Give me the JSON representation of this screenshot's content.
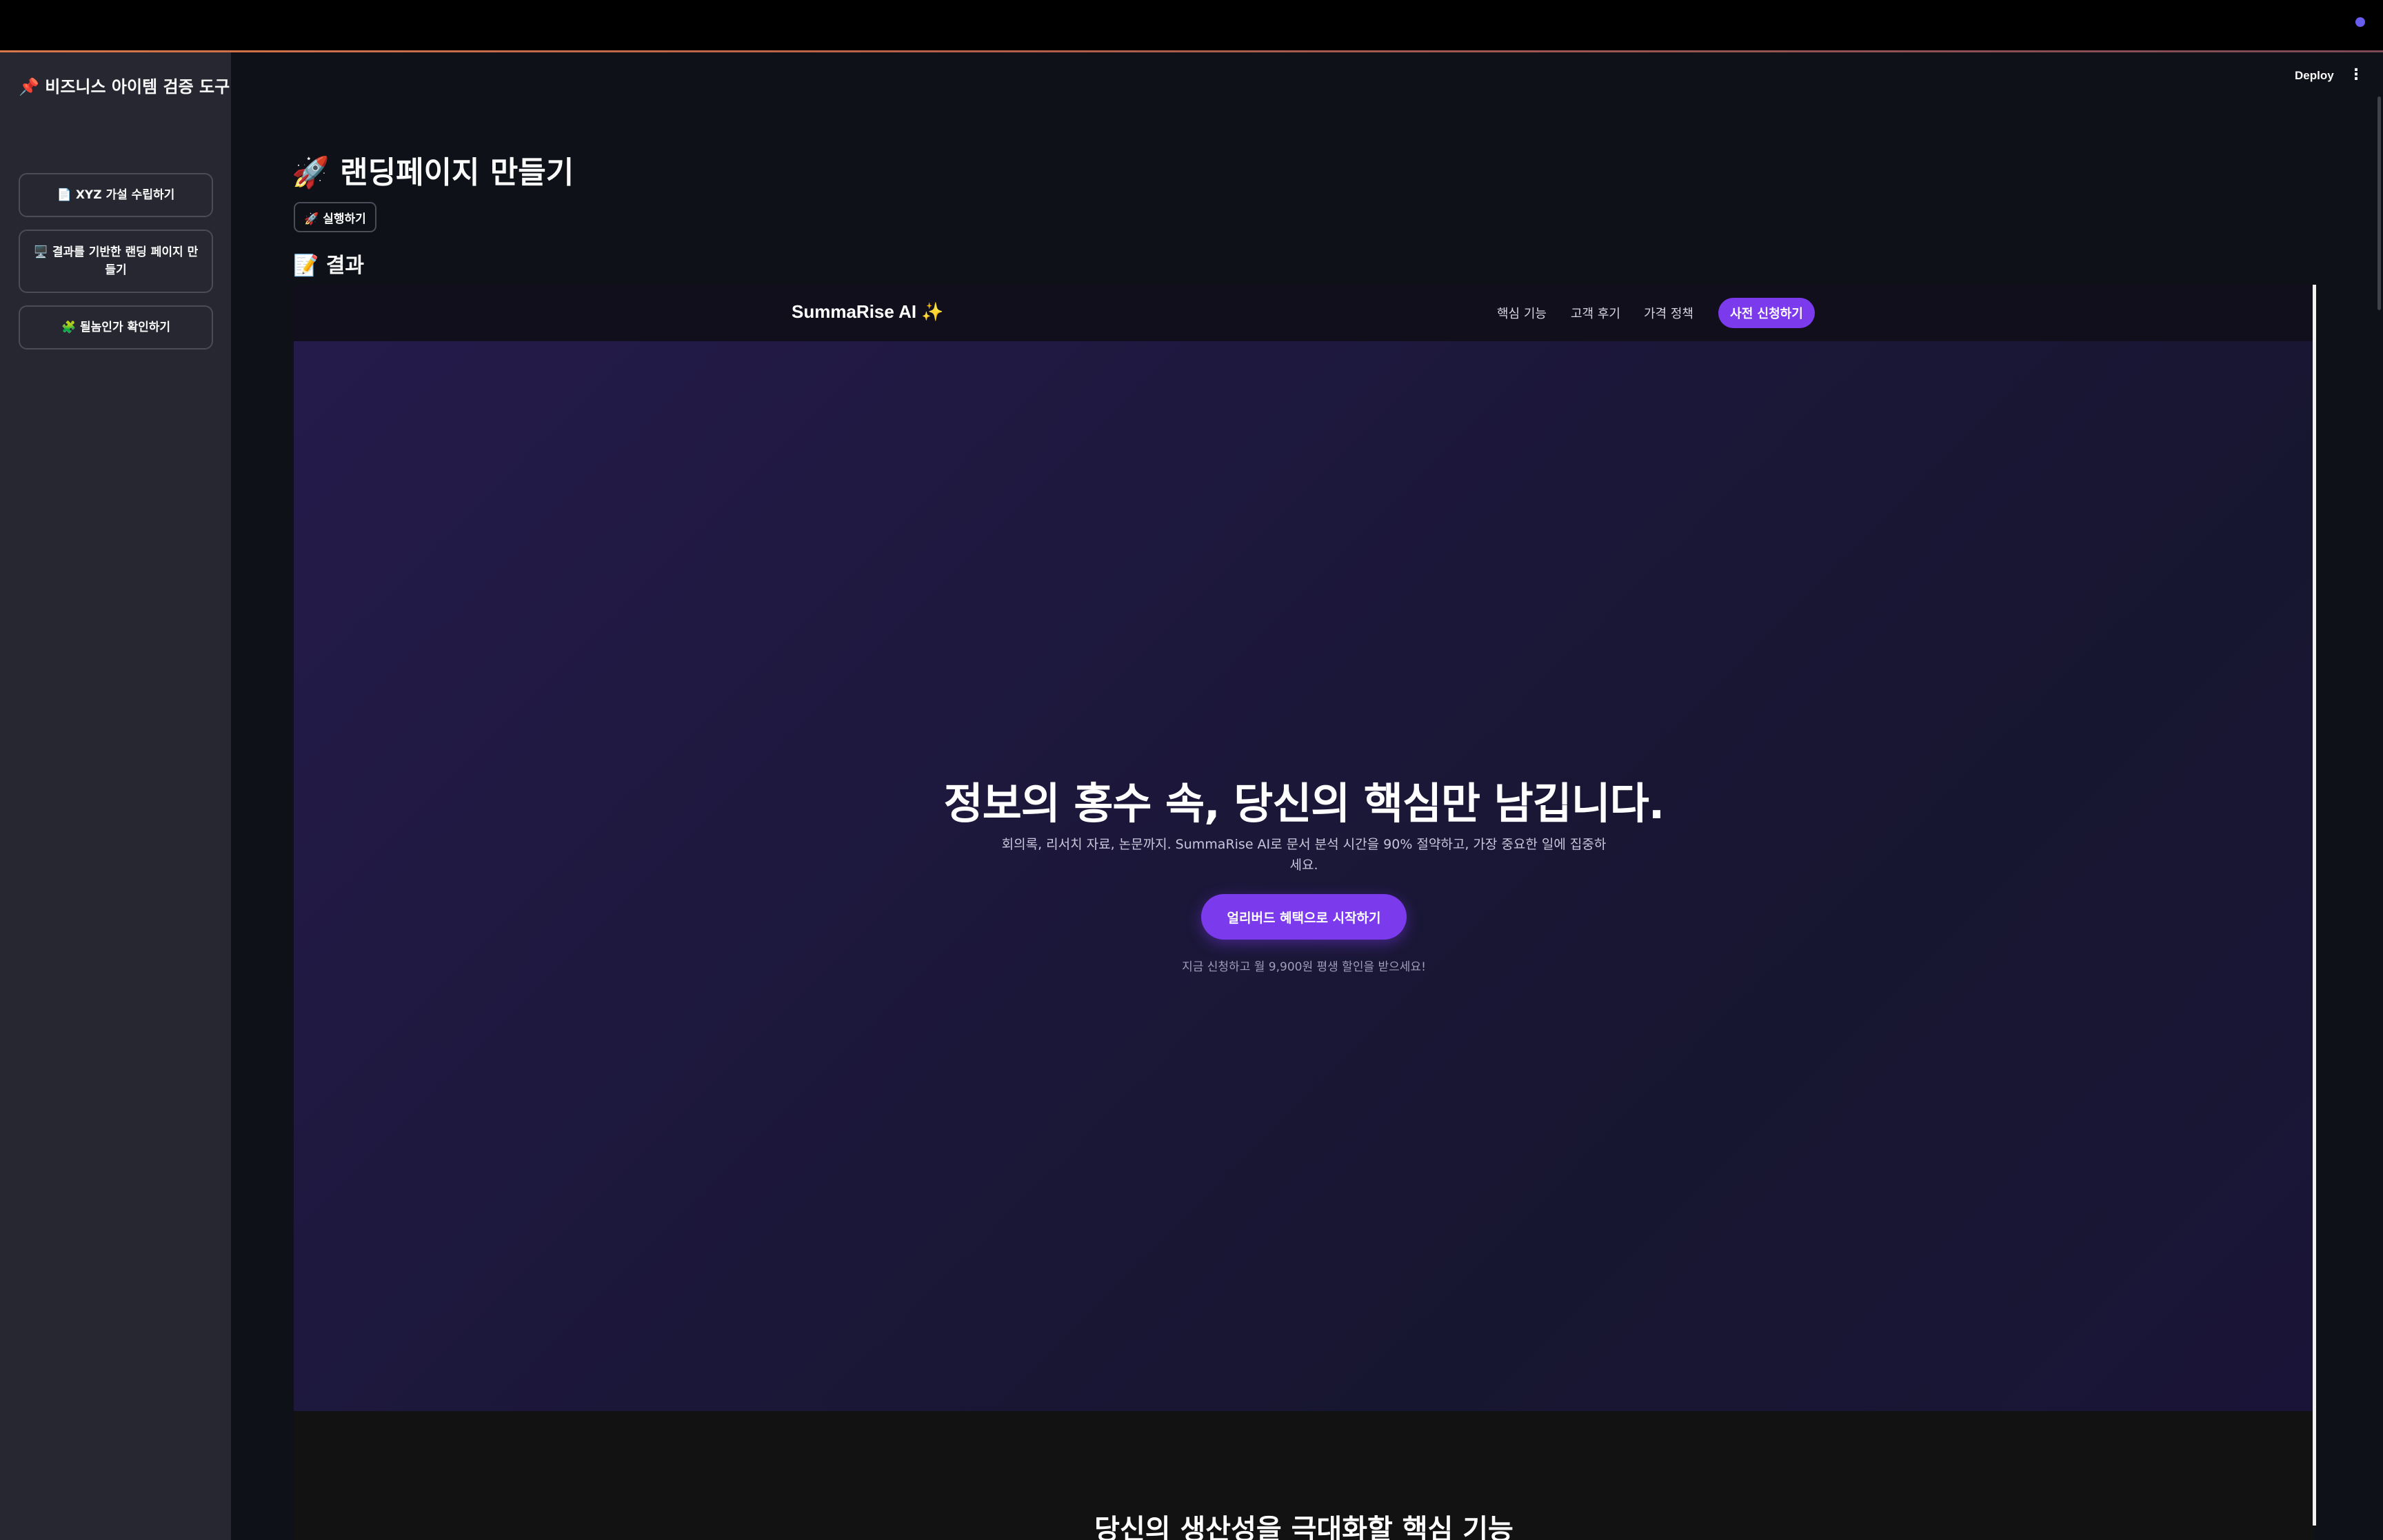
{
  "app": {
    "deploy_label": "Deploy",
    "menu_icon": "⋮"
  },
  "sidebar": {
    "title": "📌 비즈니스 아이템 검증 도구",
    "items": [
      {
        "label": "📄 XYZ 가설 수립하기"
      },
      {
        "label": "🖥️ 결과를 기반한 랜딩 페이지 만들기"
      },
      {
        "label": "🧩 될놈인가 확인하기"
      }
    ]
  },
  "main": {
    "title": "🚀 랜딩페이지 만들기",
    "run_button": "🚀 실행하기",
    "result_title": "📝 결과"
  },
  "landing": {
    "brand": "SummaRise AI ✨",
    "nav": [
      "핵심 기능",
      "고객 후기",
      "가격 정책"
    ],
    "nav_cta": "사전 신청하기",
    "hero_title": "정보의 홍수 속, 당신의 핵심만 남깁니다.",
    "hero_subtitle": "회의록, 리서치 자료, 논문까지. SummaRise AI로 문서 분석 시간을 90% 절약하고, 가장 중요한 일에 집중하세요.",
    "hero_cta": "얼리버드 혜택으로 시작하기",
    "hero_note": "지금 신청하고 월 9,900원 평생 할인을 받으세요!",
    "features_title": "당신의 생산성을 극대화할 핵심 기능"
  },
  "colors": {
    "accent": "#7c3aed",
    "sidebar_bg": "#262730",
    "main_bg": "#0e1117"
  }
}
